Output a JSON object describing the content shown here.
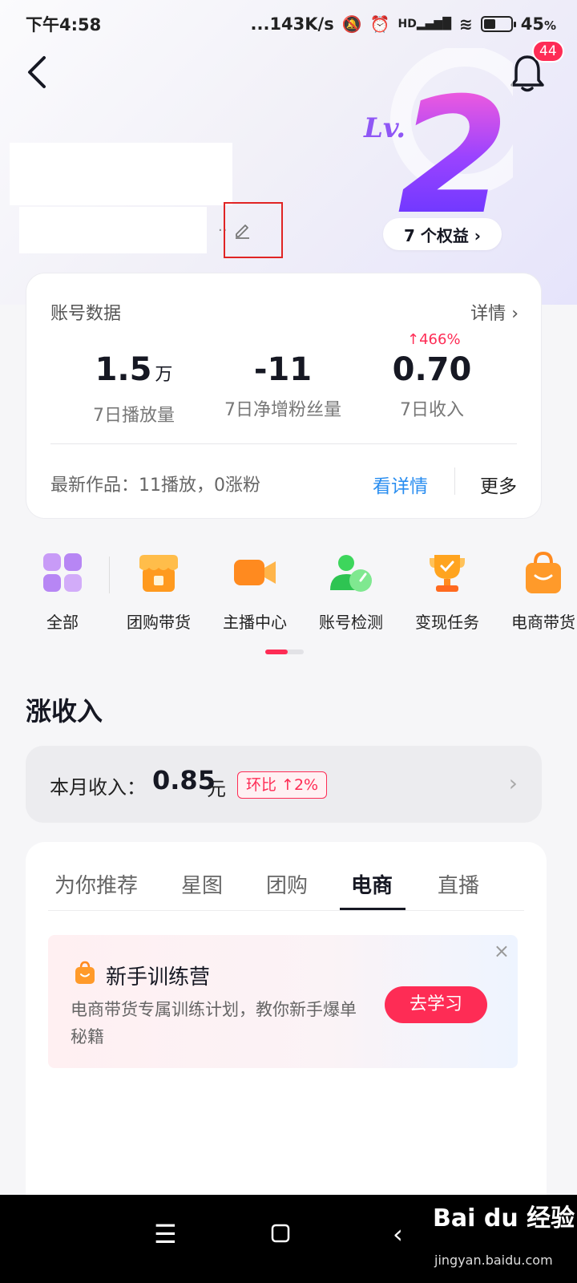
{
  "status_bar": {
    "time": "下午4:58",
    "network_speed": "...143K/s",
    "signal": "HD",
    "battery": "45",
    "battery_unit": "%",
    "battery_level": 0.45
  },
  "header": {
    "notification_count": "44",
    "level_prefix": "Lv.",
    "level": "2",
    "benefits_label": "7 个权益 ›",
    "edit_dots": "··"
  },
  "account_data": {
    "title": "账号数据",
    "detail_link": "详情",
    "stats": [
      {
        "value": "1.5",
        "unit": "万",
        "label": "7日播放量"
      },
      {
        "value": "-11",
        "unit": "",
        "label": "7日净增粉丝量"
      },
      {
        "value": "0.70",
        "unit": "",
        "label": "7日收入",
        "growth": "↑466%"
      }
    ],
    "latest": "最新作品：11播放，0涨粉",
    "see_detail": "看详情",
    "more": "更多"
  },
  "shortcuts": [
    {
      "label": "全部",
      "icon": "grid-icon"
    },
    {
      "label": "团购带货",
      "icon": "shop-icon"
    },
    {
      "label": "主播中心",
      "icon": "video-camera-icon"
    },
    {
      "label": "账号检测",
      "icon": "account-check-icon"
    },
    {
      "label": "变现任务",
      "icon": "trophy-icon"
    },
    {
      "label": "电商带货",
      "icon": "shopping-bag-icon"
    }
  ],
  "income": {
    "section_title": "涨收入",
    "label": "本月收入：",
    "value": "0.85",
    "unit": "元",
    "mom": "环比 ↑2%"
  },
  "tabs": [
    {
      "label": "为你推荐",
      "active": false
    },
    {
      "label": "星图",
      "active": false
    },
    {
      "label": "团购",
      "active": false
    },
    {
      "label": "电商",
      "active": true
    },
    {
      "label": "直播",
      "active": false
    }
  ],
  "promo": {
    "title": "新手训练营",
    "description": "电商带货专属训练计划，教你新手爆单秘籍",
    "button": "去学习",
    "close": "×"
  },
  "watermark": {
    "brand": "Bai du 经验",
    "url": "jingyan.baidu.com"
  },
  "colors": {
    "accent": "#fe2c55",
    "link": "#2a8ef0"
  }
}
